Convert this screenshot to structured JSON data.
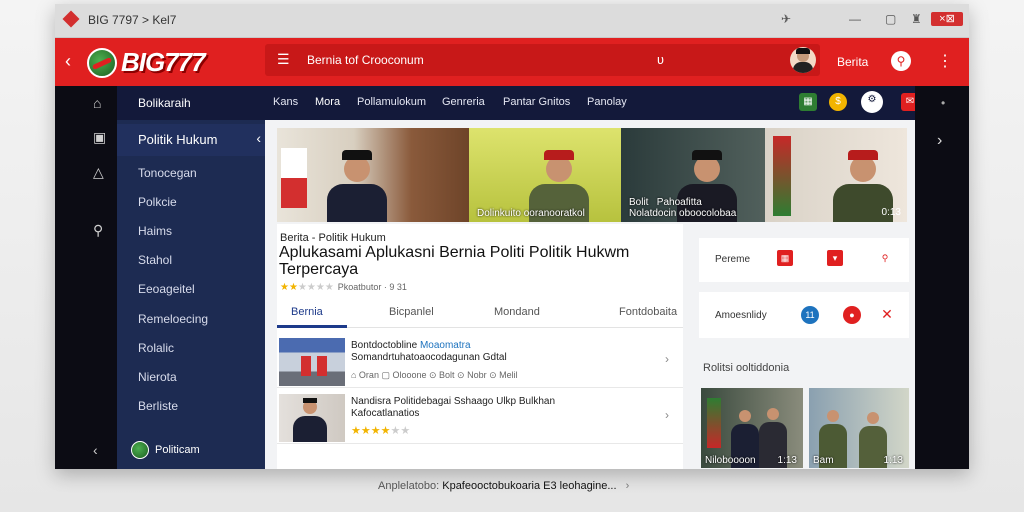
{
  "window": {
    "title": "BIG 7797 > Kel7",
    "close_label": "×⊠"
  },
  "header": {
    "logo_text": "BIG777",
    "search_placeholder": "Bernia tof Crooconum",
    "user_label": "Berita",
    "menu_icon": "hamburger-icon",
    "mic_icon": "mic-icon"
  },
  "sidebar": {
    "top_label": "Bolikaraih",
    "active_label": "Politik Hukum",
    "items": [
      "Tonocegan",
      "Polkcie",
      "Haims",
      "Stahol",
      "Eeoageitel",
      "Remeloecing",
      "Rolalic",
      "Nierota",
      "Berliste"
    ],
    "footer_label": "Politicam"
  },
  "topnav": {
    "items": [
      "Kans",
      "Mora",
      "Pollamulokum",
      "Genreria",
      "Pantar Gnitos",
      "Panolay"
    ]
  },
  "banner": {
    "slides": [
      {
        "label": ""
      },
      {
        "label": "Dolinkuito ooranooratkol"
      },
      {
        "label": "Bolit   Pahoafitta\nNolatdocin oboocolobaa"
      },
      {
        "label": ""
      }
    ],
    "counter": "0:13"
  },
  "article": {
    "breadcrumb": "Berita - Politik Hukum",
    "title": "Aplukasami Aplukasni Bernia Politi Politik Hukwm Terpercaya",
    "rating_meta": "Pkoatbutor · 9 31",
    "tabs": [
      "Bernia",
      "Bicpanlel",
      "Mondand",
      "Fontdobaita"
    ],
    "active_tab": "Bernia"
  },
  "list": [
    {
      "title_plain": "Bontdoctobline",
      "title_link": "Moaomatra",
      "subtitle": "Somandrtuhatoaocodagunan Gdtal",
      "meta": "⌂ Oran   ▢ Olooone   ⊙ Bolt   ⊙ Nobr   ⊙ Melil"
    },
    {
      "title_plain": "Nandisra Politidebagai Sshaago Ulkp Bulkhan",
      "title_link": "",
      "subtitle": "Kafocatlanatios",
      "meta": ""
    }
  ],
  "widgets": [
    {
      "label": "Pereme"
    },
    {
      "label": "Amoesnlidy",
      "badge": "11"
    }
  ],
  "related": {
    "heading": "Rolitsi ooltiddonia",
    "thumbs": [
      {
        "label": "Niloboooon",
        "count": "1:13"
      },
      {
        "label": "Bam",
        "count": "1:13"
      }
    ]
  },
  "caption": {
    "muted": "Anplelatobo:",
    "text": "Kpafeooctobukoaria E3 leohagine..."
  },
  "colors": {
    "brand_red": "#e02020",
    "navy": "#1d2b52",
    "link_blue": "#1e73be"
  }
}
